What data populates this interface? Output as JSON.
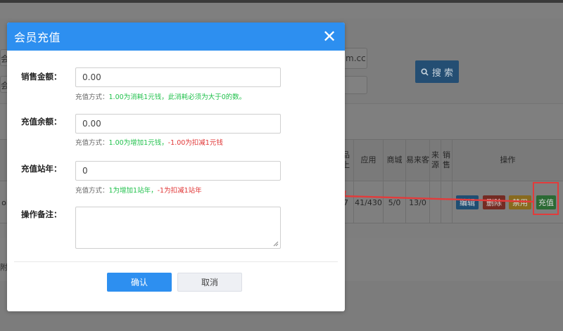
{
  "modal": {
    "title": "会员充值",
    "close_glyph": "✕",
    "fields": [
      {
        "label": "销售金额：",
        "value": "0.00",
        "hint_prefix": "充值方式：",
        "hint_green": "1.00为消耗1元钱，此消耗必须为大于0的数。",
        "hint_red": ""
      },
      {
        "label": "充值余额：",
        "value": "0.00",
        "hint_prefix": "充值方式：",
        "hint_green": "1.00为增加1元钱，",
        "hint_red": "-1.00为扣减1元钱"
      },
      {
        "label": "充值站年：",
        "value": "0",
        "hint_prefix": "充值方式：",
        "hint_green": "1为增加1站年，",
        "hint_red": "-1为扣减1站年"
      }
    ],
    "remark_label": "操作备注：",
    "remark_value": "",
    "confirm_label": "确认",
    "cancel_label": "取消"
  },
  "background": {
    "input_1_text": "m.cc",
    "input_left_1": "会",
    "input_left_2": "会",
    "search_label": "搜 索",
    "table": {
      "headers": [
        "上",
        "应用",
        "商城",
        "易来客",
        "来源",
        "销售",
        "操作"
      ],
      "partial_header_top": "品",
      "partial_header_mid": "上",
      "row": {
        "left_clip": "oi",
        "c1": "7",
        "c2": "41/430",
        "c3": "5/0",
        "c4": "13/0"
      },
      "actions": [
        "编辑",
        "删除",
        "禁用",
        "充值"
      ]
    },
    "left_bottom_text": "附"
  },
  "colors": {
    "header_blue": "#2d8ff0",
    "hint_green": "#21c14c",
    "hint_red": "#e03434",
    "highlight_red": "#e23b3b"
  }
}
